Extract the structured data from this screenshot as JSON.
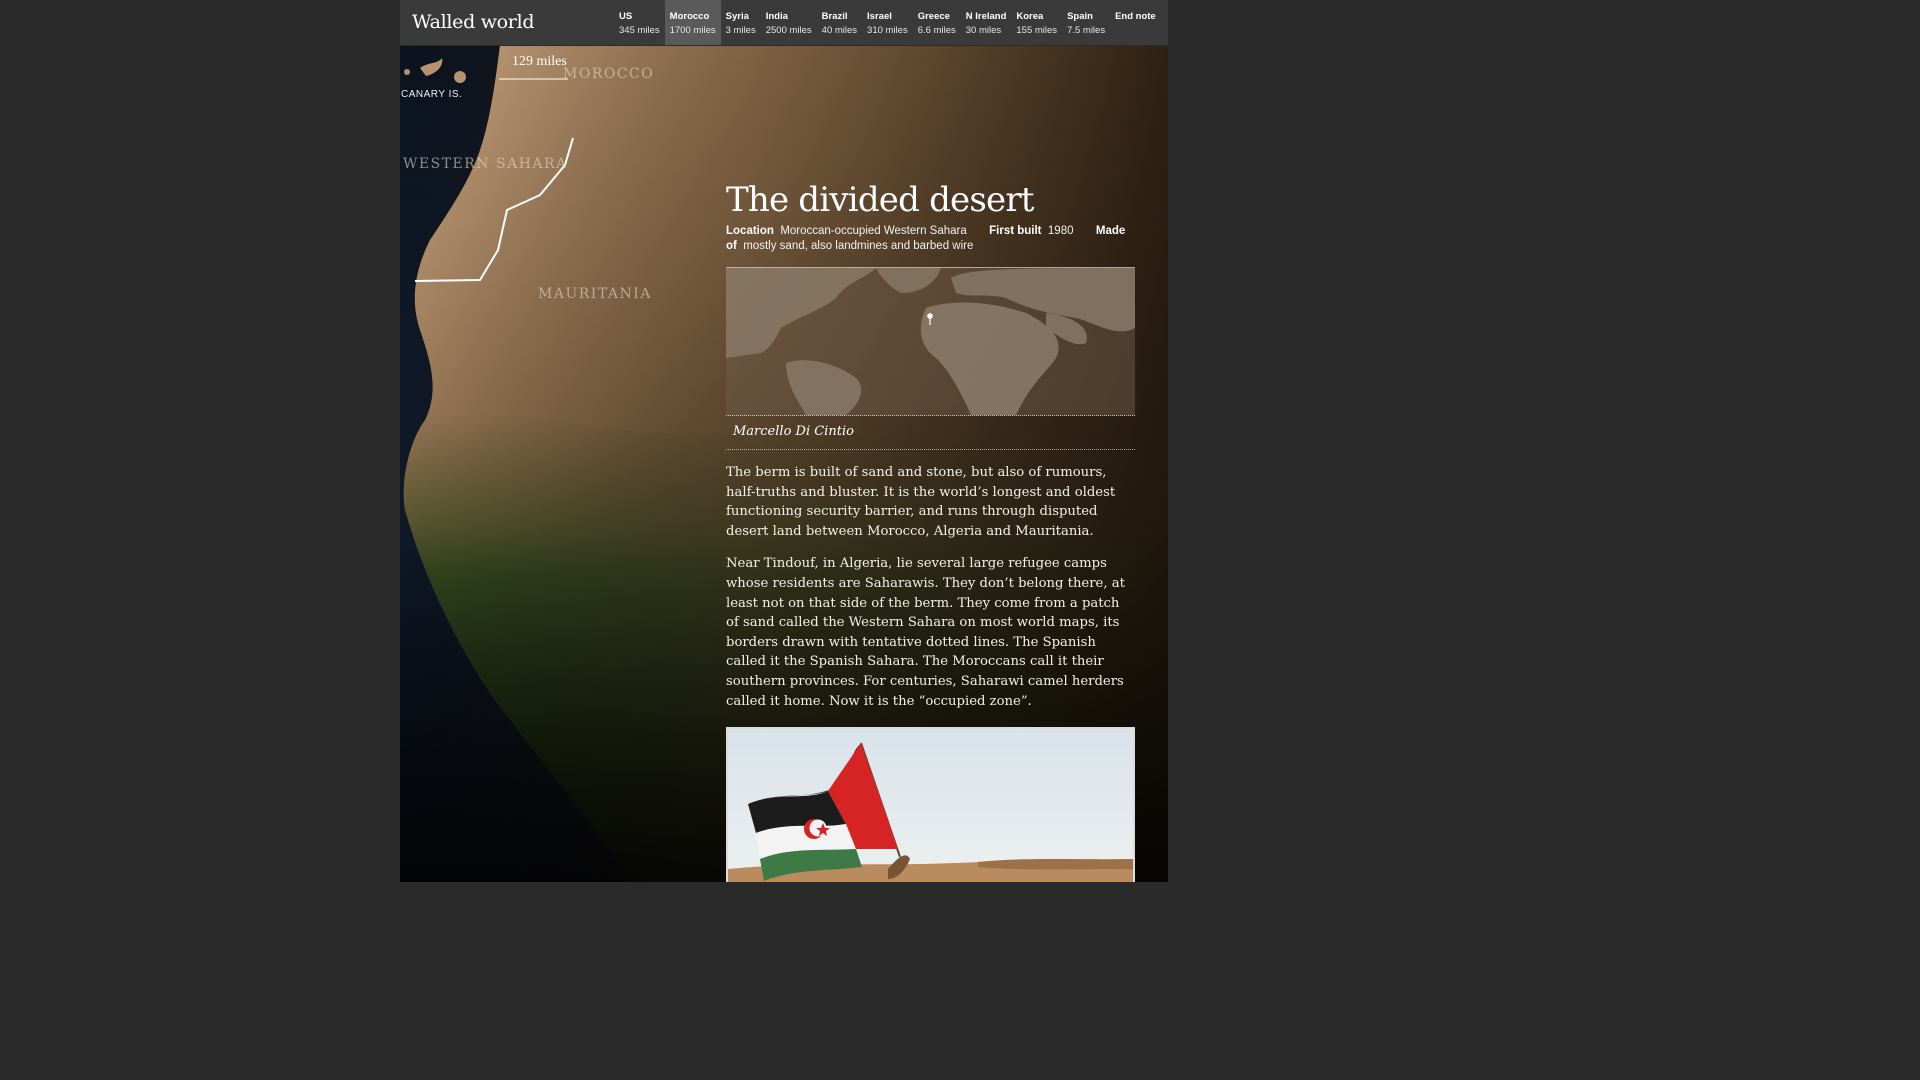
{
  "header": {
    "site_title": "Walled world",
    "nav": [
      {
        "name": "US",
        "miles": "345 miles",
        "active": false
      },
      {
        "name": "Morocco",
        "miles": "1700 miles",
        "active": true
      },
      {
        "name": "Syria",
        "miles": "3 miles",
        "active": false
      },
      {
        "name": "India",
        "miles": "2500 miles",
        "active": false
      },
      {
        "name": "Brazil",
        "miles": "40 miles",
        "active": false
      },
      {
        "name": "Israel",
        "miles": "310 miles",
        "active": false
      },
      {
        "name": "Greece",
        "miles": "6.6 miles",
        "active": false
      },
      {
        "name": "N Ireland",
        "miles": "30 miles",
        "active": false
      },
      {
        "name": "Korea",
        "miles": "155 miles",
        "active": false
      },
      {
        "name": "Spain",
        "miles": "7.5 miles",
        "active": false
      },
      {
        "name": "End note",
        "miles": "",
        "active": false
      }
    ]
  },
  "map": {
    "canary_label": "CANARY IS.",
    "scale_label": "129 miles",
    "morocco_label": "MOROCCO",
    "western_sahara_label": "WESTERN SAHARA",
    "mauritania_label": "MAURITANIA"
  },
  "article": {
    "title": "The divided desert",
    "location_label": "Location",
    "location_value": "Moroccan-occupied Western Sahara",
    "first_built_label": "First built",
    "first_built_value": "1980",
    "made_of_label": "Made of",
    "made_of_value": "mostly sand, also landmines and barbed wire",
    "credit": "Marcello Di Cintio",
    "paragraphs": [
      "The berm is built of sand and stone, but also of rumours, half-truths and bluster. It is the world’s longest and oldest functioning security barrier, and runs through disputed desert land between Morocco, Algeria and Mauritania.",
      "Near Tindouf, in Algeria, lie several large refugee camps whose residents are Saharawis. They don’t belong there, at least not on that side of the berm. They come from a patch of sand called the Western Sahara on most world maps, its borders drawn with tentative dotted lines. The Spanish called it the Spanish Sahara. The Moroccans call it their southern provinces. For centuries, Saharawi camel herders called it home. Now it is the “occupied zone”."
    ]
  },
  "colors": {
    "topbar": "#3a3a3a",
    "active_tab": "#5a5a5a",
    "desert": "#c49a6c",
    "vegetation": "#3e5a25",
    "ocean": "#0f1a2b"
  }
}
